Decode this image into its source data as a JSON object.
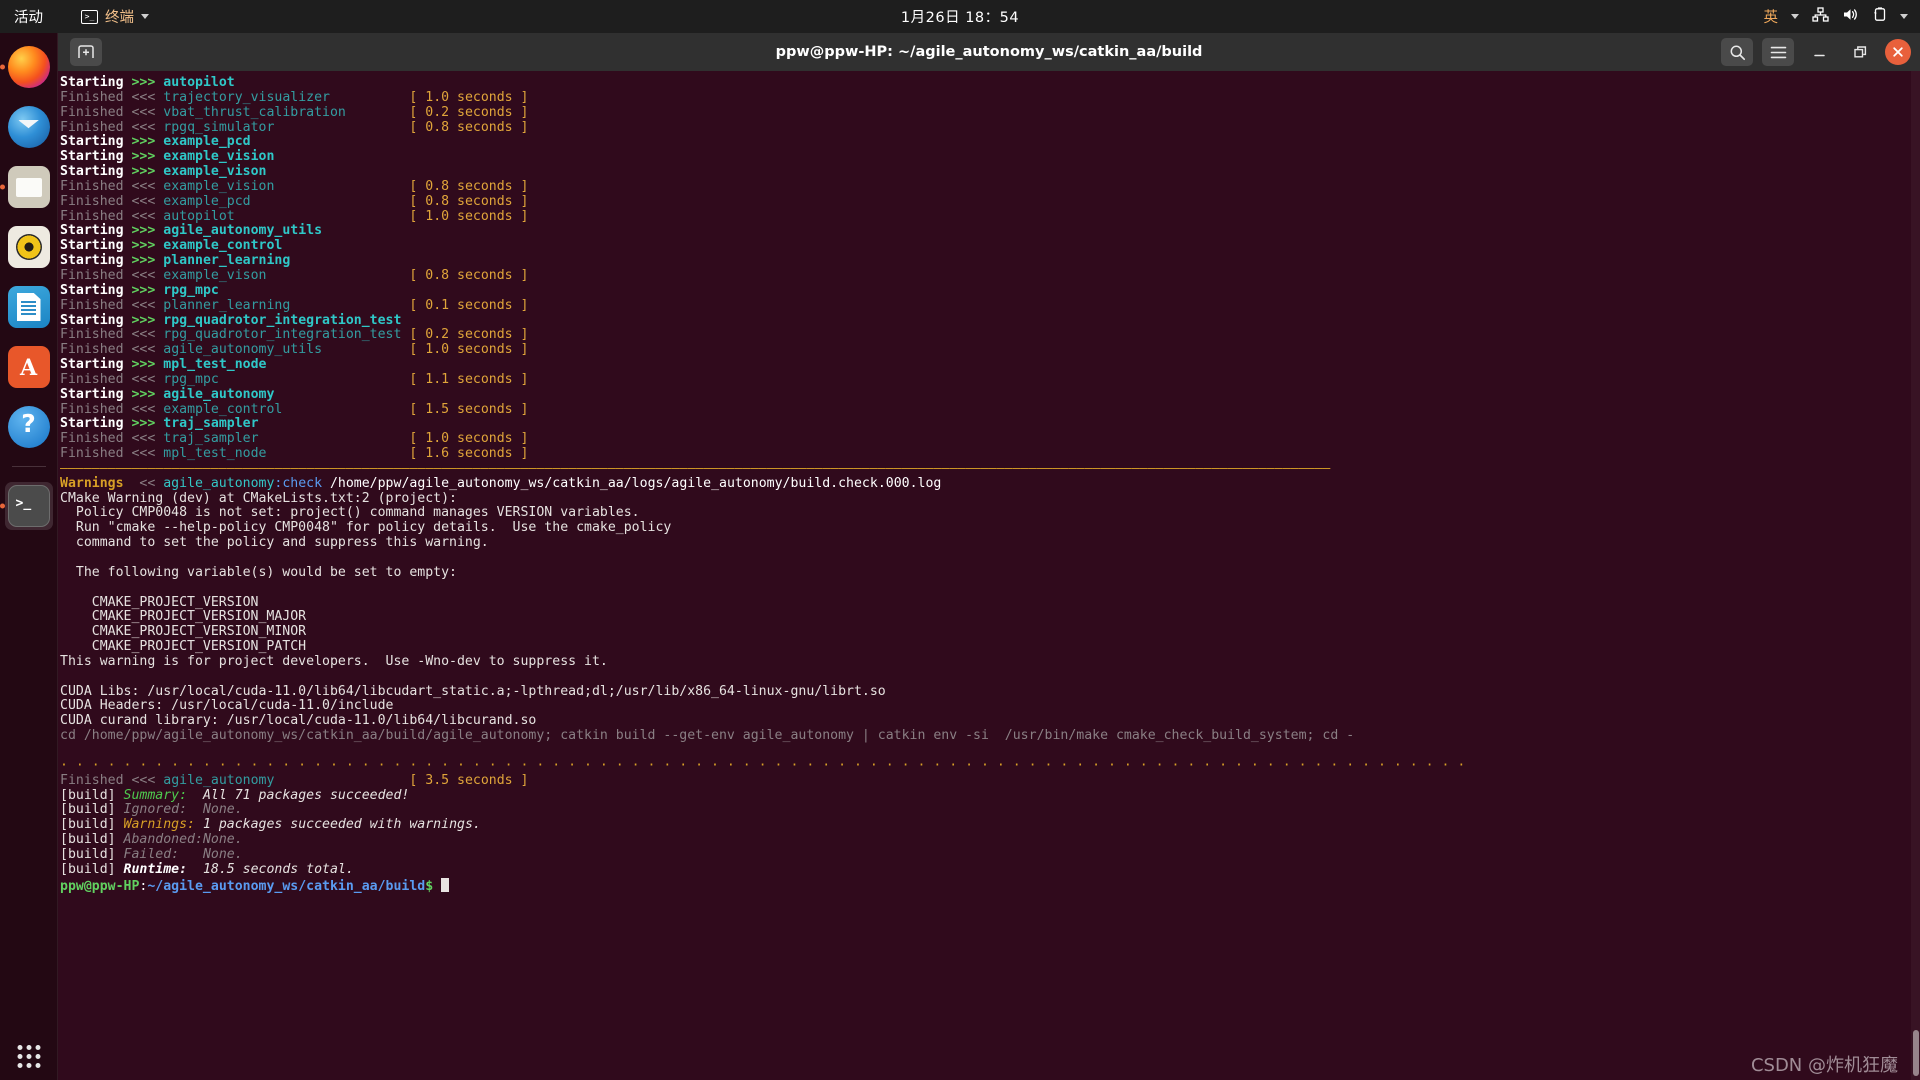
{
  "topbar": {
    "activities": "活动",
    "app_name": "终端",
    "app_icon": "terminal-icon",
    "clock": "1月26日 18：54",
    "input_method": "英",
    "tray_icons": [
      "network-icon",
      "volume-icon",
      "battery-icon",
      "chevron-down-icon"
    ]
  },
  "dock": {
    "items": [
      {
        "name": "firefox",
        "label": "Firefox",
        "running": true
      },
      {
        "name": "thunderbird",
        "label": "Thunderbird Mail",
        "running": false
      },
      {
        "name": "files",
        "label": "Files",
        "running": true
      },
      {
        "name": "rhythmbox",
        "label": "Rhythmbox",
        "running": false
      },
      {
        "name": "writer",
        "label": "LibreOffice Writer",
        "running": false
      },
      {
        "name": "software",
        "label": "Ubuntu Software",
        "running": false
      },
      {
        "name": "help",
        "label": "Help",
        "running": false
      },
      {
        "name": "terminal",
        "label": "Terminal",
        "running": true
      }
    ],
    "show_apps_label": "Show Applications"
  },
  "window": {
    "title": "ppw@ppw-HP: ~/agile_autonomy_ws/catkin_aa/build",
    "new_tab_label": "+",
    "search_label": "Search",
    "menu_label": "Menu",
    "minimize_label": "Minimize",
    "maximize_label": "Maximize",
    "close_label": "Close"
  },
  "watermark": "CSDN @炸机狂魔",
  "terminal": {
    "dash_line": "————————————————————————————————————————————————————————————————————————————————————————————————————————————————————————————————————————————————————————————————",
    "dot_line": "· · · · · · · · · · · · · · · · · · · · · · · · · · · · · · · · · · · · · · · · · · · · · · · · · · · · · · · · · · · · · · · · · · · · · · · · · · · · · · · · · · · · · · · · ·",
    "build_rows": [
      {
        "state": "Starting",
        "arrow": ">>>",
        "pkg": "autopilot",
        "time": ""
      },
      {
        "state": "Finished",
        "arrow": "<<<",
        "pkg": "trajectory_visualizer",
        "time": "[ 1.0 seconds ]"
      },
      {
        "state": "Finished",
        "arrow": "<<<",
        "pkg": "vbat_thrust_calibration",
        "time": "[ 0.2 seconds ]"
      },
      {
        "state": "Finished",
        "arrow": "<<<",
        "pkg": "rpgq_simulator",
        "time": "[ 0.8 seconds ]"
      },
      {
        "state": "Starting",
        "arrow": ">>>",
        "pkg": "example_pcd",
        "time": ""
      },
      {
        "state": "Starting",
        "arrow": ">>>",
        "pkg": "example_vision",
        "time": ""
      },
      {
        "state": "Starting",
        "arrow": ">>>",
        "pkg": "example_vison",
        "time": ""
      },
      {
        "state": "Finished",
        "arrow": "<<<",
        "pkg": "example_vision",
        "time": "[ 0.8 seconds ]"
      },
      {
        "state": "Finished",
        "arrow": "<<<",
        "pkg": "example_pcd",
        "time": "[ 0.8 seconds ]"
      },
      {
        "state": "Finished",
        "arrow": "<<<",
        "pkg": "autopilot",
        "time": "[ 1.0 seconds ]"
      },
      {
        "state": "Starting",
        "arrow": ">>>",
        "pkg": "agile_autonomy_utils",
        "time": ""
      },
      {
        "state": "Starting",
        "arrow": ">>>",
        "pkg": "example_control",
        "time": ""
      },
      {
        "state": "Starting",
        "arrow": ">>>",
        "pkg": "planner_learning",
        "time": ""
      },
      {
        "state": "Finished",
        "arrow": "<<<",
        "pkg": "example_vison",
        "time": "[ 0.8 seconds ]"
      },
      {
        "state": "Starting",
        "arrow": ">>>",
        "pkg": "rpg_mpc",
        "time": ""
      },
      {
        "state": "Finished",
        "arrow": "<<<",
        "pkg": "planner_learning",
        "time": "[ 0.1 seconds ]"
      },
      {
        "state": "Starting",
        "arrow": ">>>",
        "pkg": "rpg_quadrotor_integration_test",
        "time": ""
      },
      {
        "state": "Finished",
        "arrow": "<<<",
        "pkg": "rpg_quadrotor_integration_test",
        "time": "[ 0.2 seconds ]"
      },
      {
        "state": "Finished",
        "arrow": "<<<",
        "pkg": "agile_autonomy_utils",
        "time": "[ 1.0 seconds ]"
      },
      {
        "state": "Starting",
        "arrow": ">>>",
        "pkg": "mpl_test_node",
        "time": ""
      },
      {
        "state": "Finished",
        "arrow": "<<<",
        "pkg": "rpg_mpc",
        "time": "[ 1.1 seconds ]"
      },
      {
        "state": "Starting",
        "arrow": ">>>",
        "pkg": "agile_autonomy",
        "time": ""
      },
      {
        "state": "Finished",
        "arrow": "<<<",
        "pkg": "example_control",
        "time": "[ 1.5 seconds ]"
      },
      {
        "state": "Starting",
        "arrow": ">>>",
        "pkg": "traj_sampler",
        "time": ""
      },
      {
        "state": "Finished",
        "arrow": "<<<",
        "pkg": "traj_sampler",
        "time": "[ 1.0 seconds ]"
      },
      {
        "state": "Finished",
        "arrow": "<<<",
        "pkg": "mpl_test_node",
        "time": "[ 1.6 seconds ]"
      }
    ],
    "warning_header": {
      "label": "Warnings",
      "arrow": "<<",
      "pkg": "agile_autonomy",
      "stage": ":check",
      "path": "/home/ppw/agile_autonomy_ws/catkin_aa/logs/agile_autonomy/build.check.000.log"
    },
    "warning_body": [
      "CMake Warning (dev) at CMakeLists.txt:2 (project):",
      "  Policy CMP0048 is not set: project() command manages VERSION variables.",
      "  Run \"cmake --help-policy CMP0048\" for policy details.  Use the cmake_policy",
      "  command to set the policy and suppress this warning.",
      "",
      "  The following variable(s) would be set to empty:",
      "",
      "    CMAKE_PROJECT_VERSION",
      "    CMAKE_PROJECT_VERSION_MAJOR",
      "    CMAKE_PROJECT_VERSION_MINOR",
      "    CMAKE_PROJECT_VERSION_PATCH",
      "This warning is for project developers.  Use -Wno-dev to suppress it.",
      "",
      "CUDA Libs: /usr/local/cuda-11.0/lib64/libcudart_static.a;-lpthread;dl;/usr/lib/x86_64-linux-gnu/librt.so",
      "CUDA Headers: /usr/local/cuda-11.0/include",
      "CUDA curand library: /usr/local/cuda-11.0/lib64/libcurand.so"
    ],
    "cd_command": "cd /home/ppw/agile_autonomy_ws/catkin_aa/build/agile_autonomy; catkin build --get-env agile_autonomy | catkin env -si  /usr/bin/make cmake_check_build_system; cd -",
    "final_row": {
      "state": "Finished",
      "arrow": "<<<",
      "pkg": "agile_autonomy",
      "time": "[ 3.5 seconds ]"
    },
    "summary": [
      {
        "tag": "[build]",
        "label": "Summary:",
        "value": "All 71 packages succeeded!",
        "style": "green"
      },
      {
        "tag": "[build]",
        "label": "Ignored:",
        "value": "None.",
        "style": "dim"
      },
      {
        "tag": "[build]",
        "label": "Warnings:",
        "value": "1 packages succeeded with warnings.",
        "style": "yellow"
      },
      {
        "tag": "[build]",
        "label": "Abandoned:",
        "value": "None.",
        "style": "dim"
      },
      {
        "tag": "[build]",
        "label": "Failed:",
        "value": "None.",
        "style": "dim"
      },
      {
        "tag": "[build]",
        "label": "Runtime:",
        "value": "18.5 seconds total.",
        "style": "white"
      }
    ],
    "prompt": {
      "user_host": "ppw@ppw-HP",
      "colon": ":",
      "path": "~/agile_autonomy_ws/catkin_aa/build",
      "sigil": "$",
      "input": ""
    }
  }
}
